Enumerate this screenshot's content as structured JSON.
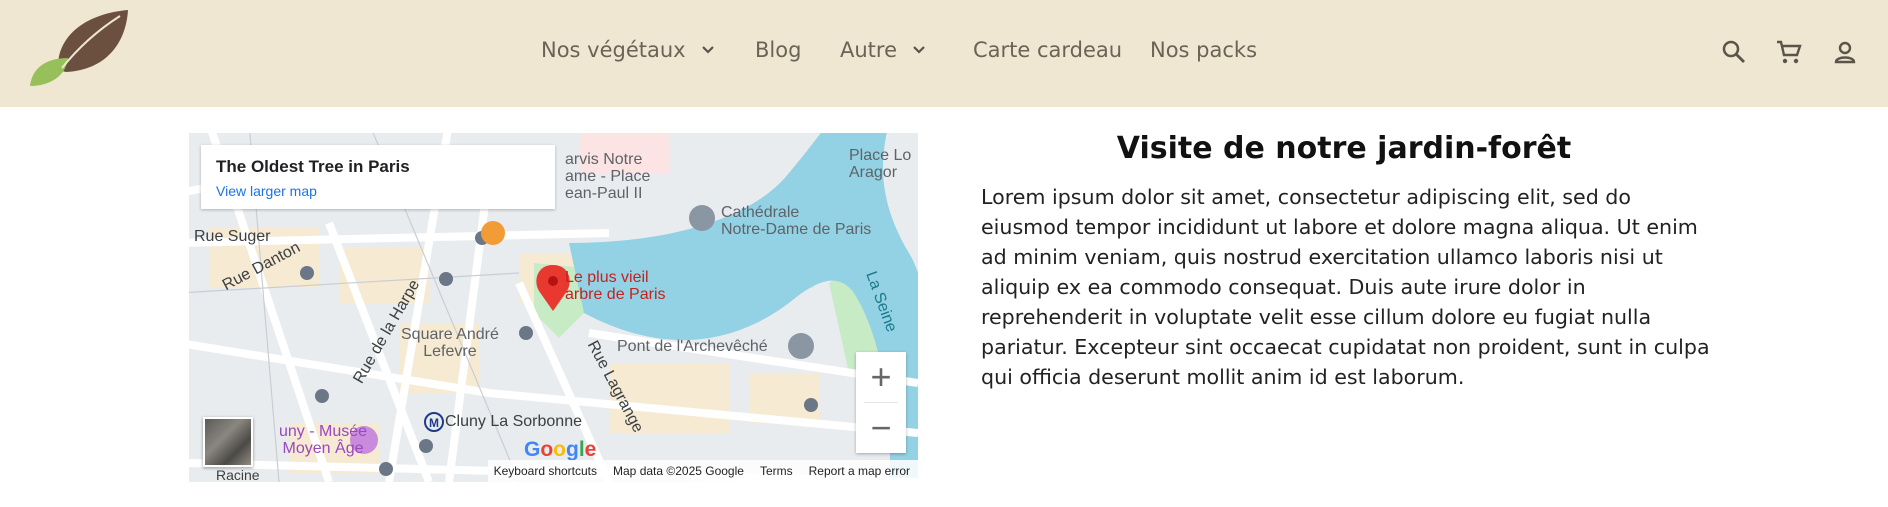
{
  "header": {
    "logo_icon": "leaf-logo-icon",
    "nav": [
      {
        "label": "Nos végétaux",
        "has_dropdown": true
      },
      {
        "label": "Blog",
        "has_dropdown": false
      },
      {
        "label": "Autre",
        "has_dropdown": true
      },
      {
        "label": "Carte cardeau",
        "has_dropdown": false
      },
      {
        "label": "Nos packs",
        "has_dropdown": false
      }
    ],
    "icons": [
      "search-icon",
      "cart-icon",
      "account-icon"
    ],
    "background": "#efe7d1"
  },
  "map": {
    "card_title": "The Oldest Tree in Paris",
    "card_link": "View larger map",
    "pin_label_line1": "Le plus vieil",
    "pin_label_line2": "arbre de Paris",
    "labels": {
      "cathedral_1": "Cathédrale",
      "cathedral_2": "Notre-Dame de Paris",
      "notre_1": "arvis Notre",
      "notre_2": "ame - Place",
      "notre_3": "ean-Paul II",
      "place_lo": "Place Lo",
      "aragon": "Aragor",
      "rue_suger": "Rue Suger",
      "rue_danton": "Rue Danton",
      "rue_harpe": "Rue de la Harpe",
      "square_1": "Square André",
      "square_2": "Lefevre",
      "pont": "Pont de l'Archevêché",
      "rue_lagrange": "Rue Lagrange",
      "la_seine": "La Seine",
      "cluny_sorbonne": "Cluny La Sorbonne",
      "cluny_musee_1": "uny - Musée",
      "cluny_musee_2": "Moyen Âge",
      "racine": "Racine"
    },
    "zoom_in": "+",
    "zoom_out": "−",
    "google": "Google",
    "attribution": [
      "Keyboard shortcuts",
      "Map data ©2025 Google",
      "Terms",
      "Report a map error"
    ]
  },
  "section": {
    "title": "Visite de notre jardin-forêt",
    "body": "Lorem ipsum dolor sit amet, consectetur adipiscing elit, sed do eiusmod tempor incididunt ut labore et dolore magna aliqua. Ut enim ad minim veniam, quis nostrud exercitation ullamco laboris nisi ut aliquip ex ea commodo consequat. Duis aute irure dolor in reprehenderit in voluptate velit esse cillum dolore eu fugiat nulla pariatur. Excepteur sint occaecat cupidatat non proident, sunt in culpa qui officia deserunt mollit anim id est laborum."
  }
}
